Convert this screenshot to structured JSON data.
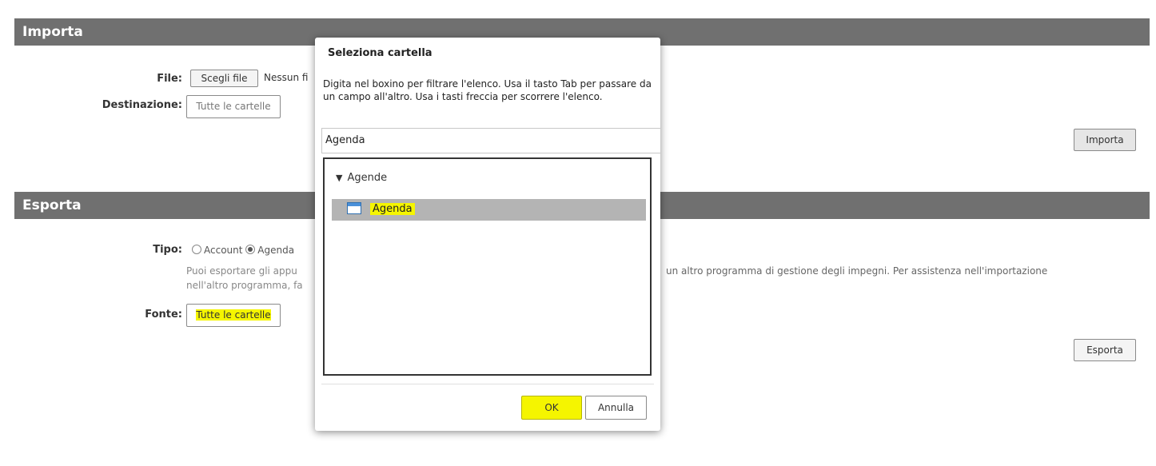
{
  "import_section": {
    "title": "Importa",
    "file_label": "File:",
    "choose_file_button": "Scegli file",
    "no_file_text": "Nessun fi",
    "destination_label": "Destinazione:",
    "destination_button": "Tutte le cartelle",
    "import_button": "Importa"
  },
  "export_section": {
    "title": "Esporta",
    "type_label": "Tipo:",
    "radio_account": "Account",
    "radio_agenda": "Agenda",
    "desc_left_line1": "Puoi esportare gli appu",
    "desc_left_line2": "nell'altro programma, fa",
    "desc_right_line1": "un altro programma di gestione degli impegni. Per assistenza nell'importazione",
    "source_label": "Fonte:",
    "source_button": "Tutte le cartelle",
    "export_button": "Esporta"
  },
  "dialog": {
    "title": "Seleziona cartella",
    "description": "Digita nel boxino per filtrare l'elenco. Usa il tasto Tab per passare da un campo all'altro. Usa i tasti freccia per scorrere l'elenco.",
    "filter_value": "Agenda",
    "tree_parent_arrow": "▼",
    "tree_parent": "Agende",
    "tree_child": "Agenda",
    "ok_button": "OK",
    "cancel_button": "Annulla"
  },
  "colors": {
    "section_header": "#707070",
    "highlight": "#f5f500",
    "selected_row": "#b4b4b4"
  }
}
